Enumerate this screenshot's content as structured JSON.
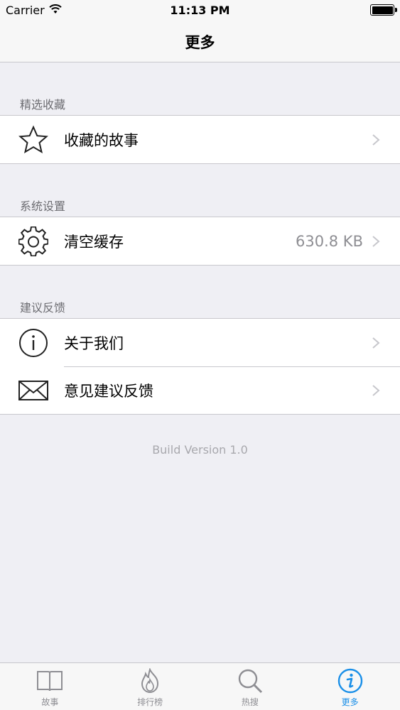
{
  "status_bar": {
    "carrier": "Carrier",
    "time": "11:13 PM"
  },
  "nav": {
    "title": "更多"
  },
  "sections": [
    {
      "header": "精选收藏",
      "items": [
        {
          "label": "收藏的故事",
          "icon": "star-icon",
          "detail": ""
        }
      ]
    },
    {
      "header": "系统设置",
      "items": [
        {
          "label": "清空缓存",
          "icon": "gear-icon",
          "detail": "630.8 KB"
        }
      ]
    },
    {
      "header": "建议反馈",
      "items": [
        {
          "label": "关于我们",
          "icon": "info-icon",
          "detail": ""
        },
        {
          "label": "意见建议反馈",
          "icon": "mail-icon",
          "detail": ""
        }
      ]
    }
  ],
  "footer": {
    "build_version": "Build Version 1.0"
  },
  "tabs": [
    {
      "label": "故事",
      "icon": "book-icon",
      "active": false
    },
    {
      "label": "排行榜",
      "icon": "flame-icon",
      "active": false
    },
    {
      "label": "热搜",
      "icon": "search-icon",
      "active": false
    },
    {
      "label": "更多",
      "icon": "info-circle-icon",
      "active": true
    }
  ],
  "colors": {
    "accent": "#1a8fe8",
    "background": "#efeff4",
    "secondary_text": "#8e8e93"
  }
}
